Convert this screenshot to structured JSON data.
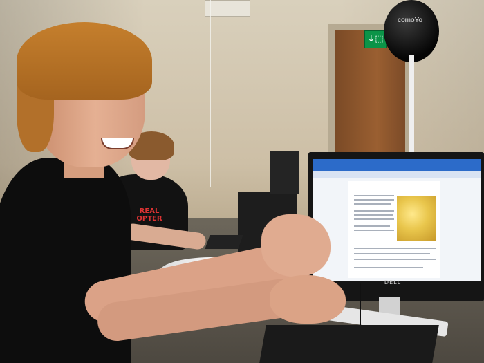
{
  "scene": {
    "exit_sign_glyph": "↓⬚",
    "balloon_text": "comoYo",
    "shirt_text": "REAL\nOPTER",
    "monitor_brand": "DELL",
    "doc_title": "......",
    "colors": {
      "wall": "#cdbfa6",
      "door": "#9a5f31",
      "exit_sign": "#0b9448",
      "shirt": "#0d0d0d",
      "hair": "#c57f2d",
      "browser_bar": "#2c6bc9"
    }
  }
}
